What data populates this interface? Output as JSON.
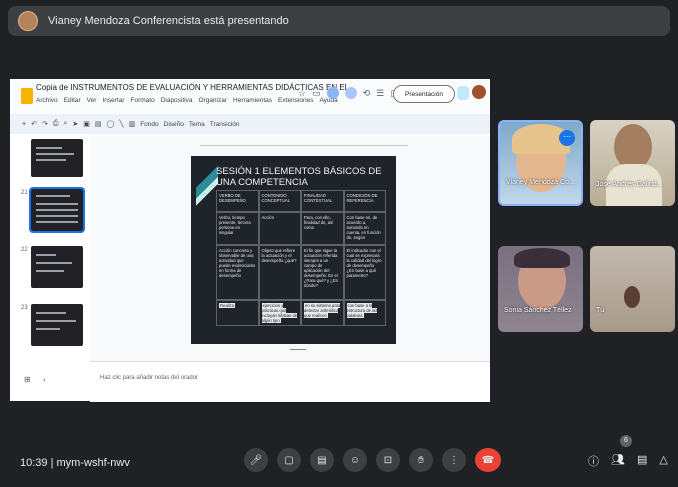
{
  "presenter": {
    "text": "Vianey Mendoza Conferencista está presentando"
  },
  "doc": {
    "title": "Copia de INSTRUMENTOS DE EVALUACIÓN Y HERRAMIENTAS DIDÁCTICAS EN EL...",
    "menu": [
      "Archivo",
      "Editar",
      "Ver",
      "Insertar",
      "Formato",
      "Diapositiva",
      "Organizar",
      "Herramientas",
      "Extensiones",
      "Ayuda"
    ],
    "present_label": "Presentación",
    "toolbar": [
      "Fondo",
      "Diseño",
      "Tema",
      "Transición"
    ],
    "thumb_numbers": [
      "21",
      "22",
      "23"
    ],
    "notes_placeholder": "Haz clic para añadir notas del orador"
  },
  "slide": {
    "title": "SESIÓN 1 ELEMENTOS BÁSICOS DE UNA COMPETENCIA",
    "headers": [
      "VERBO DE DESEMPEÑO",
      "CONTENIDO CONCEPTUAL",
      "FINALIDAD CONTEXTUAL",
      "CONDICIÓN DE REFERENCIA"
    ],
    "row2": [
      "Verbo, tiempo presente, tercera persona en singular",
      "Acción",
      "Para, con ello, finalidad de, así como",
      "Con base en, de acuerdo a, tomando en cuenta, en función de, según"
    ],
    "row3": [
      "Acción concreta y observable de una actividad que puede evidenciarse en forma de desempeño",
      "Objeto que refiere la actuación y el desempeño ¿qué?",
      "El fin que sigue la actuación referida siempre a un campo de aplicación del desempeño. En el ¿Para qué? y ¿En dónde?",
      "El indicador con el cual se expresará la calidad del logro de desempeño ¿En base a qué parametro?"
    ],
    "row4": [
      "Realiza",
      "ejercicios y prácticas que incluyan sílabas de algún tipo",
      "en su sistema para detectar aritmética que realicen",
      "con base a la estructura de las palabras"
    ]
  },
  "participants": [
    {
      "name": "Vianey Mendoza Co..."
    },
    {
      "name": "José Andrés Galind..."
    },
    {
      "name": "Sonia Sánchez Téllez"
    },
    {
      "name": "Tú"
    }
  ],
  "meeting": {
    "time": "10:39",
    "code": "mym-wshf-nwv",
    "participant_count": "6"
  }
}
